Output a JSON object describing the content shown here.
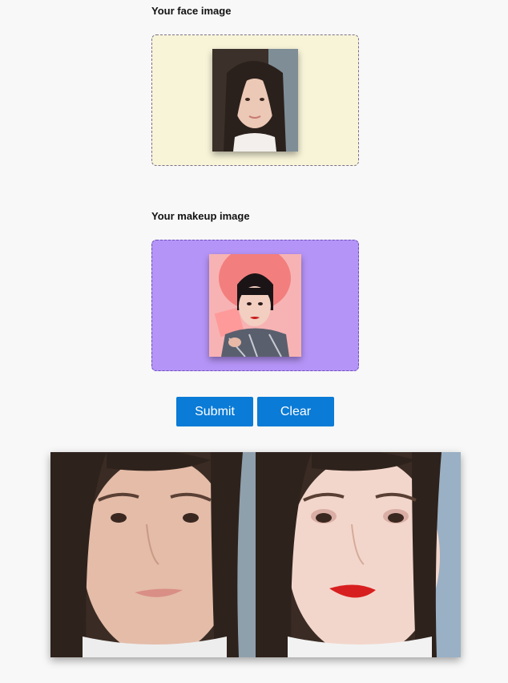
{
  "face_section": {
    "label": "Your face image",
    "image_icon": "portrait-photo"
  },
  "makeup_section": {
    "label": "Your makeup image",
    "image_icon": "portrait-photo"
  },
  "buttons": {
    "submit": "Submit",
    "clear": "Clear"
  },
  "result": {
    "before_icon": "face-photo",
    "after_icon": "face-photo-with-makeup"
  },
  "colors": {
    "face_zone_bg": "#f8f4d8",
    "makeup_zone_bg": "#b594f7",
    "button_bg": "#0a7bd6"
  }
}
